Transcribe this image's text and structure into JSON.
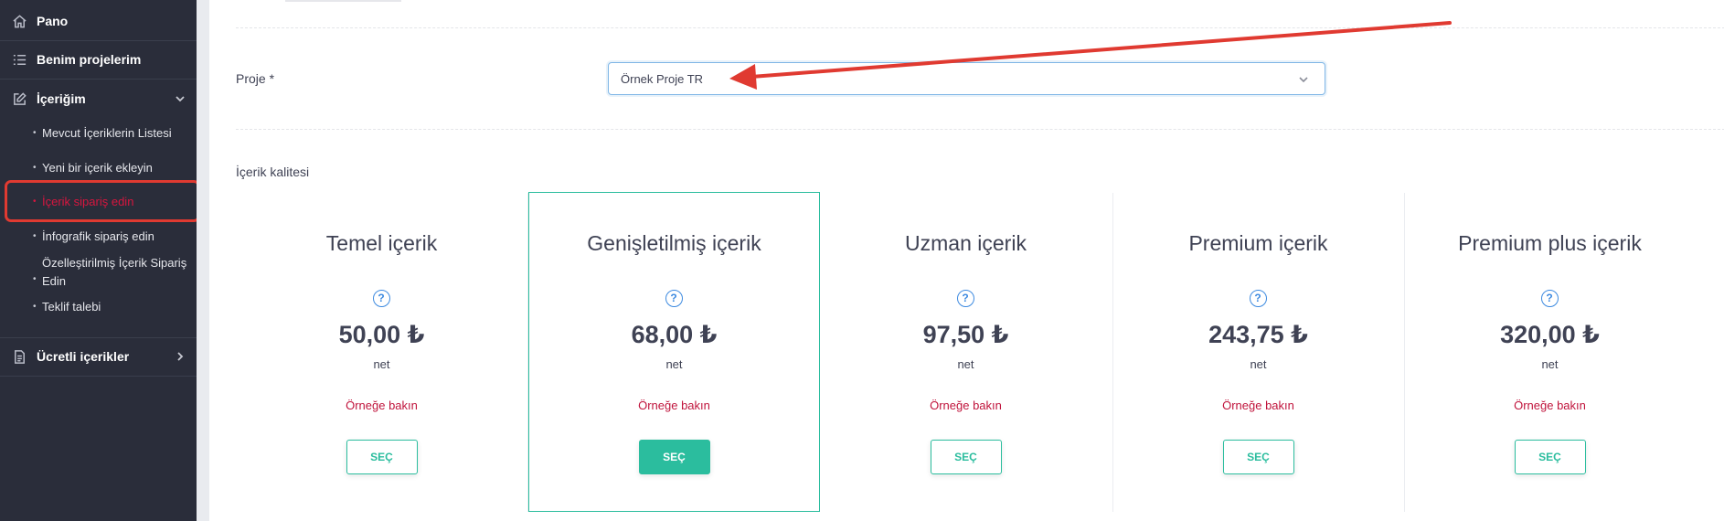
{
  "sidebar": {
    "items": [
      {
        "label": "Pano",
        "icon": "home-icon"
      },
      {
        "label": "Benim projelerim",
        "icon": "list-icon"
      },
      {
        "label": "İçeriğim",
        "icon": "edit-icon"
      },
      {
        "label": "Ücretli içerikler",
        "icon": "document-icon"
      }
    ],
    "subitems": [
      {
        "label": "Mevcut İçeriklerin Listesi"
      },
      {
        "label": "Yeni bir içerik ekleyin"
      },
      {
        "label": "İçerik sipariş edin"
      },
      {
        "label": "İnfografik sipariş edin"
      },
      {
        "label": "Özelleştirilmiş İçerik Sipariş Edin"
      },
      {
        "label": "Teklif talebi"
      }
    ],
    "active_subitem": "İçerik sipariş edin"
  },
  "form": {
    "project_label": "Proje *",
    "project_value": "Örnek Proje TR"
  },
  "quality": {
    "title": "İçerik kalitesi",
    "cards": [
      {
        "name": "Temel içerik",
        "price": "50,00 ₺",
        "unit": "net",
        "example": "Örneğe bakın",
        "button": "SEÇ",
        "selected": false
      },
      {
        "name": "Genişletilmiş içerik",
        "price": "68,00 ₺",
        "unit": "net",
        "example": "Örneğe bakın",
        "button": "SEÇ",
        "selected": true
      },
      {
        "name": "Uzman içerik",
        "price": "97,50 ₺",
        "unit": "net",
        "example": "Örneğe bakın",
        "button": "SEÇ",
        "selected": false
      },
      {
        "name": "Premium içerik",
        "price": "243,75 ₺",
        "unit": "net",
        "example": "Örneğe bakın",
        "button": "SEÇ",
        "selected": false
      },
      {
        "name": "Premium plus içerik",
        "price": "320,00 ₺",
        "unit": "net",
        "example": "Örneğe bakın",
        "button": "SEÇ",
        "selected": false
      }
    ]
  },
  "colors": {
    "sidebar_bg": "#2a2d3a",
    "accent_teal": "#2bbd9e",
    "active_red": "#d7163f",
    "annotation_red": "#e03a31",
    "help_blue": "#3d8ae0"
  }
}
